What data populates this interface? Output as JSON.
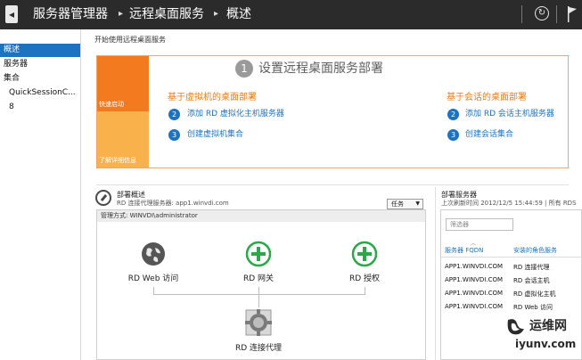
{
  "header": {
    "breadcrumbs": [
      "服务器管理器",
      "远程桌面服务",
      "概述"
    ],
    "separator": "▸",
    "back_glyph": "◂",
    "refresh_glyph": "↻"
  },
  "sidebar": {
    "items": [
      {
        "label": "概述",
        "active": true
      },
      {
        "label": "服务器",
        "active": false
      },
      {
        "label": "集合",
        "active": false
      },
      {
        "label": "QuickSessionC...",
        "active": false
      },
      {
        "label": "8",
        "active": false
      }
    ]
  },
  "quick_start": {
    "section_title": "开始使用远程桌面服务",
    "tile_top_label": "快速启动",
    "tile_bottom_label": "了解详细信息",
    "step1_number": "1",
    "heading": "设置远程桌面服务部署",
    "left": {
      "title": "基于虚拟机的桌面部署",
      "steps": [
        {
          "number": "2",
          "label": "添加 RD 虚拟化主机服务器"
        },
        {
          "number": "3",
          "label": "创建虚拟机集合"
        }
      ]
    },
    "right": {
      "title": "基于会话的桌面部署",
      "steps": [
        {
          "number": "2",
          "label": "添加 RD 会话主机服务器"
        },
        {
          "number": "3",
          "label": "创建会话集合"
        }
      ]
    }
  },
  "overview": {
    "title": "部署概述",
    "subtitle": "RD 连接代理服务器: app1.winvdi.com",
    "tasks_label": "任务",
    "tasks_arrow": "▼",
    "managed_as": "管理方式: WINVDI\\administrator",
    "nodes": [
      {
        "label": "RD Web 访问",
        "icon": "globe-icon"
      },
      {
        "label": "RD 网关",
        "icon": "plus-icon"
      },
      {
        "label": "RD 授权",
        "icon": "plus-icon"
      },
      {
        "label": "RD 连接代理",
        "icon": "broker-icon"
      }
    ]
  },
  "servers": {
    "title": "部署服务器",
    "subtitle": "上次刷新时间 2012/12/5 15:44:59 | 所有 RDS",
    "filter_placeholder": "筛选器",
    "columns": [
      "服务器 FQDN",
      "安装的角色服务"
    ],
    "sort_glyph": "︿",
    "rows": [
      {
        "fqdn": "APP1.WINVDI.COM",
        "role": "RD 连接代理"
      },
      {
        "fqdn": "APP1.WINVDI.COM",
        "role": "RD 会话主机"
      },
      {
        "fqdn": "APP1.WINVDI.COM",
        "role": "RD 虚拟化主机"
      },
      {
        "fqdn": "APP1.WINVDI.COM",
        "role": "RD Web 访问"
      }
    ]
  },
  "watermark": {
    "name": "运维网",
    "url": "iyunv.com"
  },
  "colors": {
    "header_bg": "#2b2b2b",
    "accent_blue": "#1e73c0",
    "orange": "#f47a20",
    "light_orange": "#f9b14c",
    "green": "#2aa84a"
  }
}
